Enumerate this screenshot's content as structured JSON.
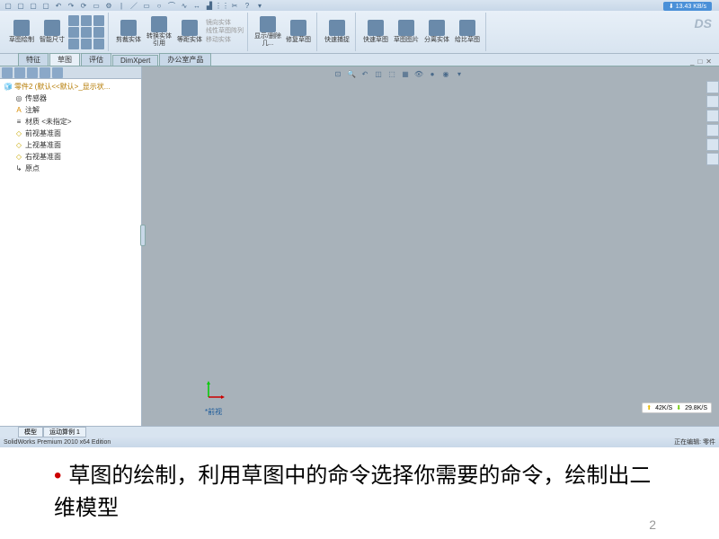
{
  "qat_icons": [
    "new",
    "open",
    "save",
    "print",
    "undo",
    "redo",
    "select",
    "rebuild",
    "options",
    "sketch",
    "line",
    "rect",
    "circle",
    "arc",
    "spline",
    "dim",
    "rel",
    "mirror",
    "pattern",
    "trim",
    "help",
    "search"
  ],
  "net_badge": "13.43 KB/s",
  "ribbon": {
    "groups": [
      {
        "big": [
          {
            "label": "草图绘制",
            "name": "sketch-draw"
          },
          {
            "label": "智能尺寸",
            "name": "smart-dimension"
          }
        ],
        "smalls": 9
      },
      {
        "big": [
          {
            "label": "剪裁实体",
            "name": "trim-entities"
          },
          {
            "label": "转换实体引用",
            "name": "convert-entities"
          },
          {
            "label": "等距实体",
            "name": "offset-entities"
          }
        ],
        "row_labels": [
          "镜向实体",
          "线性草图阵列",
          "移动实体"
        ]
      },
      {
        "big": [
          {
            "label": "显示/删除几...",
            "name": "display-delete"
          },
          {
            "label": "修复草图",
            "name": "repair-sketch"
          }
        ]
      },
      {
        "big": [
          {
            "label": "快速捕捉",
            "name": "quick-snap"
          }
        ]
      },
      {
        "big": [
          {
            "label": "快速草图",
            "name": "rapid-sketch"
          },
          {
            "label": "草图图片",
            "name": "sketch-picture"
          },
          {
            "label": "分离实体",
            "name": "split-entities"
          },
          {
            "label": "给比草图",
            "name": "scale-sketch"
          }
        ]
      }
    ]
  },
  "tabs": [
    "特征",
    "草图",
    "评估",
    "DimXpert",
    "办公室产品"
  ],
  "active_tab": 1,
  "feature_tree": {
    "root": "零件2 (默认<<默认>_显示状...",
    "items": [
      {
        "icon": "📁",
        "label": "传感器"
      },
      {
        "icon": "A",
        "label": "注解",
        "expandable": true
      },
      {
        "icon": "≡",
        "label": "材质 <未指定>"
      },
      {
        "icon": "◇",
        "label": "前视基准面"
      },
      {
        "icon": "◇",
        "label": "上视基准面"
      },
      {
        "icon": "◇",
        "label": "右视基准面"
      },
      {
        "icon": "↳",
        "label": "原点"
      }
    ]
  },
  "view_label": "*前视",
  "bottom_tabs": [
    "模型",
    "运动算例 1"
  ],
  "statusbar": {
    "edition": "SolidWorks Premium 2010 x64 Edition",
    "editing": "正在编辑: 零件"
  },
  "net_stat": {
    "up": "42K/S",
    "down": "29.8K/S"
  },
  "window_controls": [
    "_",
    "□",
    "✕"
  ],
  "logo": "DS",
  "view_toolbar_icons": [
    "zoom-fit",
    "zoom-area",
    "prev-view",
    "section",
    "view-orient",
    "display-style",
    "hide-show",
    "edit-appearance",
    "apply-scene",
    "view-settings"
  ],
  "slide": {
    "bullet": "•",
    "caption": "草图的绘制，利用草图中的命令选择你需要的命令，绘制出二维模型",
    "page": "2"
  }
}
